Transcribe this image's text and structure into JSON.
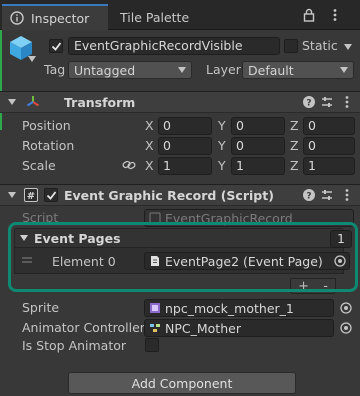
{
  "tabs": {
    "inspector": "Inspector",
    "tile_palette": "Tile Palette"
  },
  "header": {
    "object_name": "EventGraphicRecordVisible",
    "active_checked": true,
    "static_label": "Static",
    "static_checked": false,
    "tag_label": "Tag",
    "tag_value": "Untagged",
    "layer_label": "Layer",
    "layer_value": "Default"
  },
  "transform": {
    "title": "Transform",
    "position": {
      "label": "Position",
      "x": "0",
      "y": "0",
      "z": "0"
    },
    "rotation": {
      "label": "Rotation",
      "x": "0",
      "y": "0",
      "z": "0"
    },
    "scale": {
      "label": "Scale",
      "x": "1",
      "y": "1",
      "z": "1"
    },
    "axis_x": "X",
    "axis_y": "Y",
    "axis_z": "Z"
  },
  "script_component": {
    "title": "Event Graphic Record (Script)",
    "enabled": true,
    "script_label": "Script",
    "script_value": "EventGraphicRecord",
    "event_pages_label": "Event Pages",
    "event_pages_count": "1",
    "element_label": "Element 0",
    "element_value": "EventPage2 (Event Page)",
    "plus": "+",
    "minus": "-",
    "sprite_label": "Sprite",
    "sprite_value": "npc_mock_mother_1",
    "animator_label": "Animator Controller",
    "animator_value": "NPC_Mother",
    "stop_anim_label": "Is Stop Animator",
    "stop_anim_checked": false
  },
  "add_component_label": "Add Component",
  "colors": {
    "accent_green": "#0f8a72",
    "tab_highlight": "#3a79bb"
  }
}
